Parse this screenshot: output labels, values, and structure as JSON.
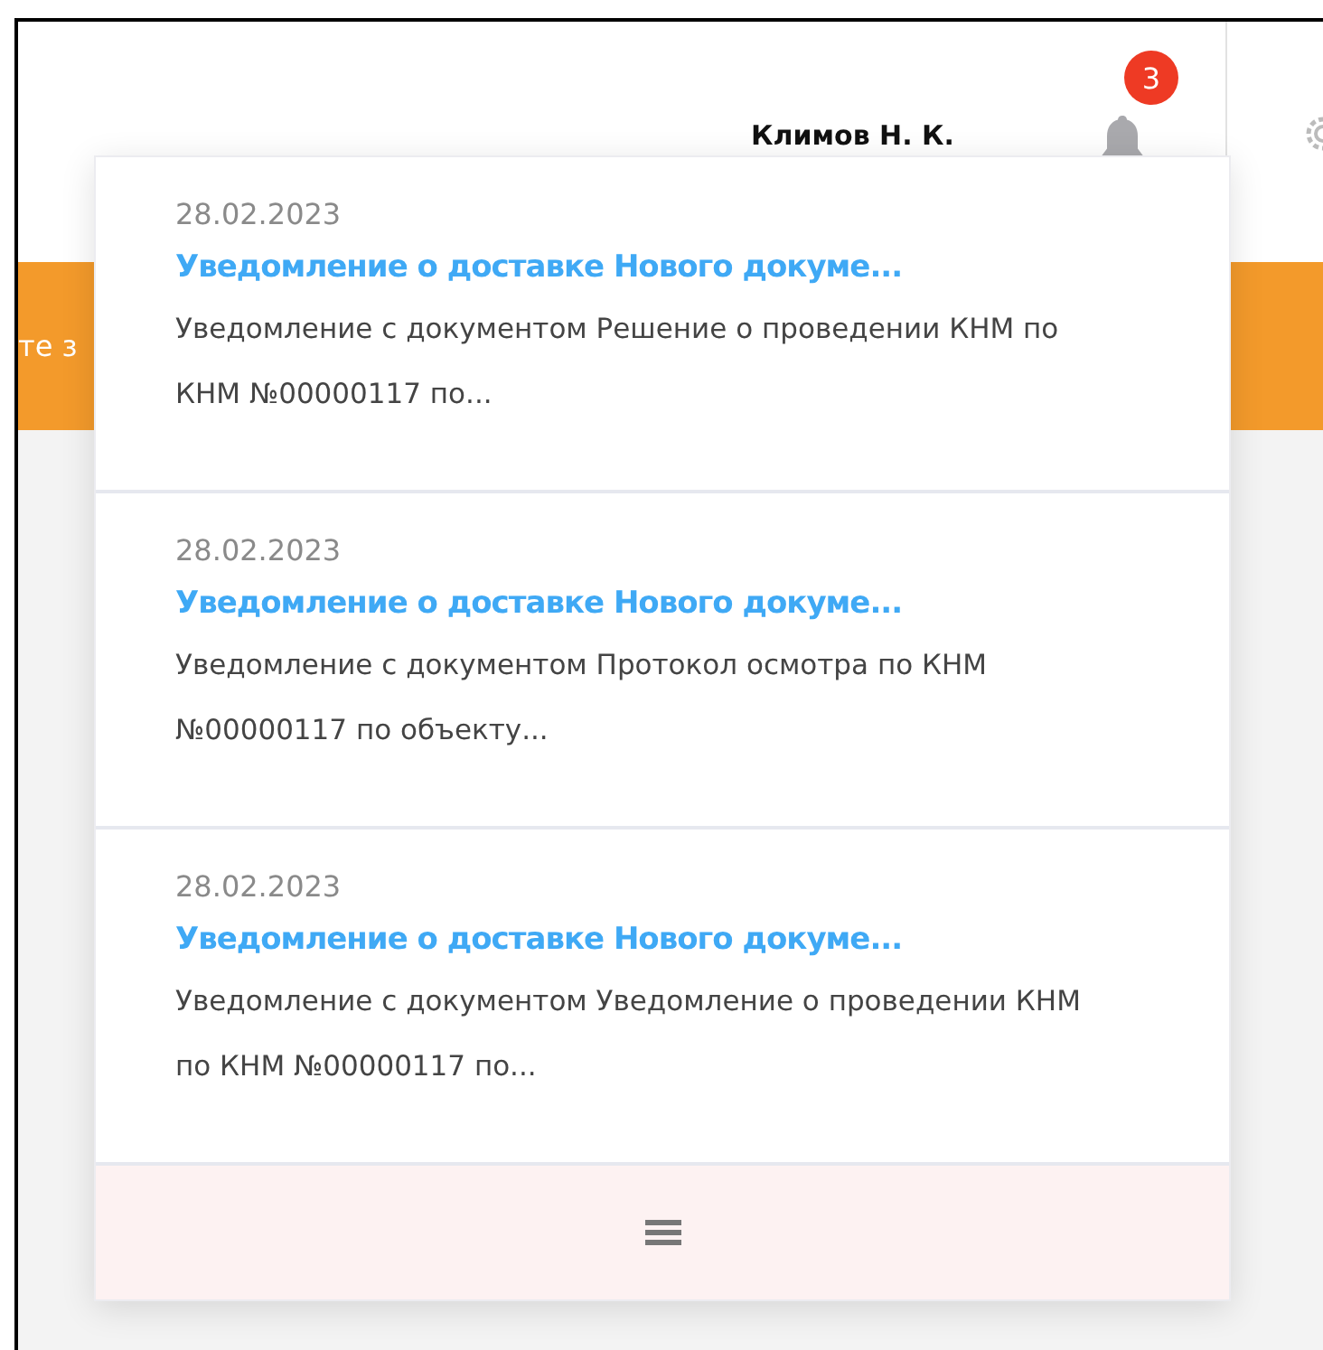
{
  "header": {
    "user_name": "Климов Н. К.",
    "notification_count": "3"
  },
  "banner": {
    "text": "те з"
  },
  "notifications": {
    "items": [
      {
        "date": "28.02.2023",
        "title": "Уведомление о доставке Нового докуме...",
        "body": "Уведомление с документом Решение о проведении КНМ по КНМ №00000117 по..."
      },
      {
        "date": "28.02.2023",
        "title": "Уведомление о доставке Нового докуме...",
        "body": "Уведомление с документом Протокол осмотра по КНМ №00000117 по объекту..."
      },
      {
        "date": "28.02.2023",
        "title": "Уведомление о доставке Нового докуме...",
        "body": "Уведомление с документом Уведомление о проведении КНМ по КНМ №00000117 по..."
      }
    ]
  }
}
